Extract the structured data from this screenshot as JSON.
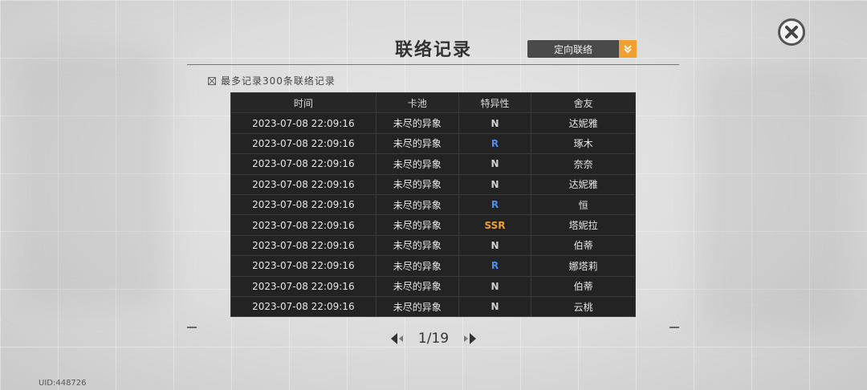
{
  "header": {
    "title": "联络记录"
  },
  "filter_dropdown": {
    "selected": "定向联络"
  },
  "limit_note": "最多记录300条联络记录",
  "table": {
    "headers": [
      "时间",
      "卡池",
      "特异性",
      "舍友"
    ],
    "rows": [
      {
        "time": "2023-07-08 22:09:16",
        "pool": "未尽的异象",
        "rarity": "N",
        "mate": "达妮雅"
      },
      {
        "time": "2023-07-08 22:09:16",
        "pool": "未尽的异象",
        "rarity": "R",
        "mate": "琢木"
      },
      {
        "time": "2023-07-08 22:09:16",
        "pool": "未尽的异象",
        "rarity": "N",
        "mate": "奈奈"
      },
      {
        "time": "2023-07-08 22:09:16",
        "pool": "未尽的异象",
        "rarity": "N",
        "mate": "达妮雅"
      },
      {
        "time": "2023-07-08 22:09:16",
        "pool": "未尽的异象",
        "rarity": "R",
        "mate": "恒"
      },
      {
        "time": "2023-07-08 22:09:16",
        "pool": "未尽的异象",
        "rarity": "SSR",
        "mate": "塔妮拉"
      },
      {
        "time": "2023-07-08 22:09:16",
        "pool": "未尽的异象",
        "rarity": "N",
        "mate": "伯蒂"
      },
      {
        "time": "2023-07-08 22:09:16",
        "pool": "未尽的异象",
        "rarity": "R",
        "mate": "娜塔莉"
      },
      {
        "time": "2023-07-08 22:09:16",
        "pool": "未尽的异象",
        "rarity": "N",
        "mate": "伯蒂"
      },
      {
        "time": "2023-07-08 22:09:16",
        "pool": "未尽的异象",
        "rarity": "N",
        "mate": "云桃"
      }
    ]
  },
  "rarity_colors": {
    "N": "#d0d0d0",
    "R": "#4a8ef0",
    "SSR": "#f0a030"
  },
  "pagination": {
    "current": "1",
    "total": "19"
  },
  "uid_label": "UID:448726",
  "icons": {
    "close": "close-icon",
    "dropdown": "chevron-down-icon",
    "prev": "prev-page-icon",
    "next": "next-page-icon"
  }
}
